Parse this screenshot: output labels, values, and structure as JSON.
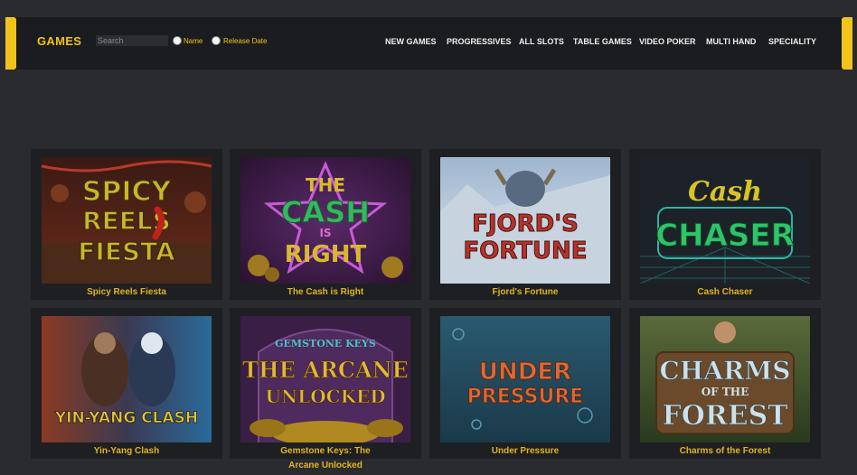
{
  "header": {
    "brand": "GAMES",
    "search": {
      "placeholder": "Search",
      "value": ""
    },
    "sort_options": [
      "Name",
      "Release Date"
    ],
    "nav": [
      "NEW GAMES",
      "PROGRESSIVES",
      "ALL SLOTS",
      "TABLE GAMES",
      "VIDEO POKER",
      "MULTI HAND",
      "SPECIALITY"
    ]
  },
  "games": [
    {
      "title": "Spicy Reels Fiesta",
      "art": [
        "SPICY",
        "REELS",
        "FIESTA"
      ]
    },
    {
      "title": "The Cash is Right",
      "art": [
        "THE",
        "CASH",
        "IS",
        "RIGHT"
      ]
    },
    {
      "title": "Fjord's Fortune",
      "art": [
        "FJORD'S",
        "FORTUNE"
      ]
    },
    {
      "title": "Cash Chaser",
      "art": [
        "Cash",
        "CHASER"
      ]
    },
    {
      "title": "Yin-Yang Clash",
      "art": [
        "YIN-YANG CLASH"
      ]
    },
    {
      "title": "Gemstone Keys: The Arcane Unlocked",
      "art": [
        "GEMSTONE KEYS",
        "THE ARCANE",
        "UNLOCKED"
      ]
    },
    {
      "title": "Under Pressure",
      "art": [
        "UNDER",
        "PRESSURE"
      ]
    },
    {
      "title": "Charms of the Forest",
      "art": [
        "CHARMS",
        "OF THE",
        "FOREST"
      ]
    }
  ],
  "colors": {
    "accent": "#f2c31b",
    "title": "#e0b524",
    "background": "#2a2b2f",
    "card": "#1e1f22"
  }
}
